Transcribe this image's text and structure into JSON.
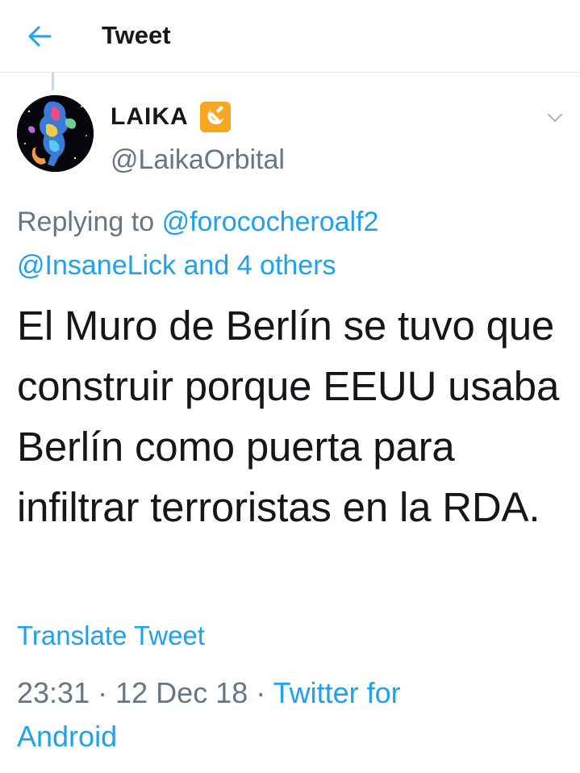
{
  "header": {
    "title": "Tweet",
    "back_icon": "arrow-left-icon",
    "accent_color": "#1da1f2"
  },
  "tweet": {
    "author": {
      "display_name": "LAIKA",
      "flag_emoji": "☭",
      "handle": "@LaikaOrbital"
    },
    "replying_prefix": "Replying to",
    "replying_user": "@forococheroalf2",
    "replying_user2": "@InsaneLick",
    "replying_others": "and 4 others",
    "text": "El Muro de Berlín se tuvo que construir porque EEUU usaba Berlín como puerta para infiltrar terroristas en la RDA.",
    "translate_label": "Translate Tweet",
    "time": "23:31",
    "date": "12 Dec 18",
    "separator": "·",
    "source": "Twitter for Android"
  }
}
